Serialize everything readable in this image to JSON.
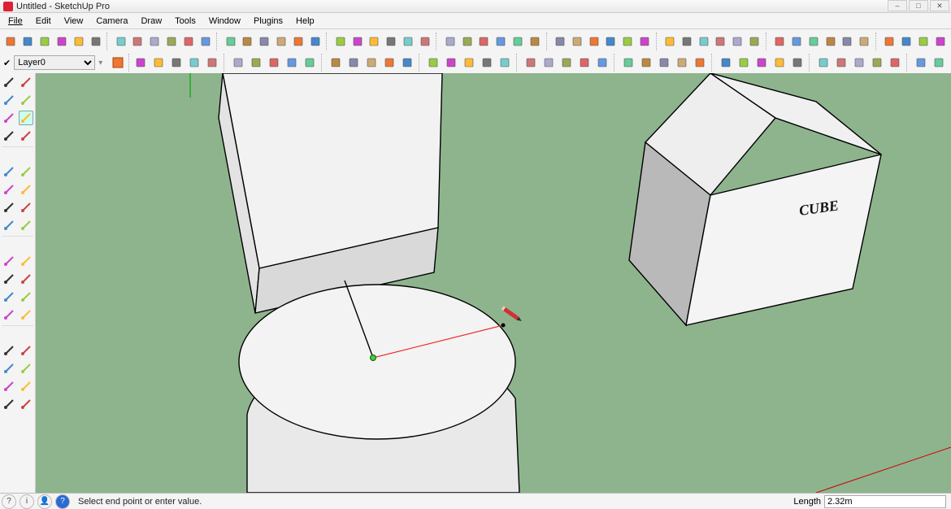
{
  "window": {
    "title": "Untitled - SketchUp Pro",
    "buttons": {
      "min": "–",
      "max": "□",
      "close": "✕"
    }
  },
  "menu": [
    "File",
    "Edit",
    "View",
    "Camera",
    "Draw",
    "Tools",
    "Window",
    "Plugins",
    "Help"
  ],
  "layers": {
    "current": "Layer0",
    "options": [
      "Layer0"
    ]
  },
  "status": {
    "hint": "Select end point or enter value.",
    "length_label": "Length",
    "length_value": "2.32m",
    "icons": [
      "?",
      "i",
      "👤",
      "?"
    ]
  },
  "scene": {
    "cube_label": "CUBE"
  },
  "toolbar_icons_row1": [
    "pencil",
    "eraser",
    "line",
    "curve",
    "rect",
    "poly",
    "rot-rect",
    "arc",
    "arc2",
    "pie",
    "freehand",
    "bezier",
    "3d-poly",
    "wedge",
    "extrude1",
    "extrude2",
    "extrude3",
    "extrude4",
    "push",
    "twist",
    "follow",
    "scale",
    "offset",
    "intersect",
    "move",
    "rotate",
    "smooth",
    "xray",
    "hidden",
    "wire",
    "shade",
    "tex",
    "mono",
    "back",
    "front",
    "top",
    "bottom",
    "left",
    "right",
    "iso",
    "p",
    "p2",
    "skin",
    "xy",
    "bub",
    "play",
    "stop",
    "rec",
    "tree",
    "bush",
    "grass",
    "person"
  ],
  "toolbar_icons_row2": [
    "undo",
    "redo",
    "back",
    "fwd",
    "hand",
    "orbit",
    "img",
    "import",
    "dim",
    "text",
    "leader",
    "cog",
    "warn",
    "info",
    "rec",
    "ray",
    "info2",
    "globe",
    "globe2",
    "sun",
    "lock",
    "fx",
    "cloud",
    "copy",
    "sphere",
    "cyl",
    "cone",
    "torus",
    "panel",
    "view",
    "user",
    "globe3",
    "home",
    "cube",
    "iso",
    "layer",
    "plan",
    "elev",
    "sec",
    "det",
    "model",
    "rend",
    "out",
    "box",
    "iso2",
    "f1",
    "f2"
  ]
}
